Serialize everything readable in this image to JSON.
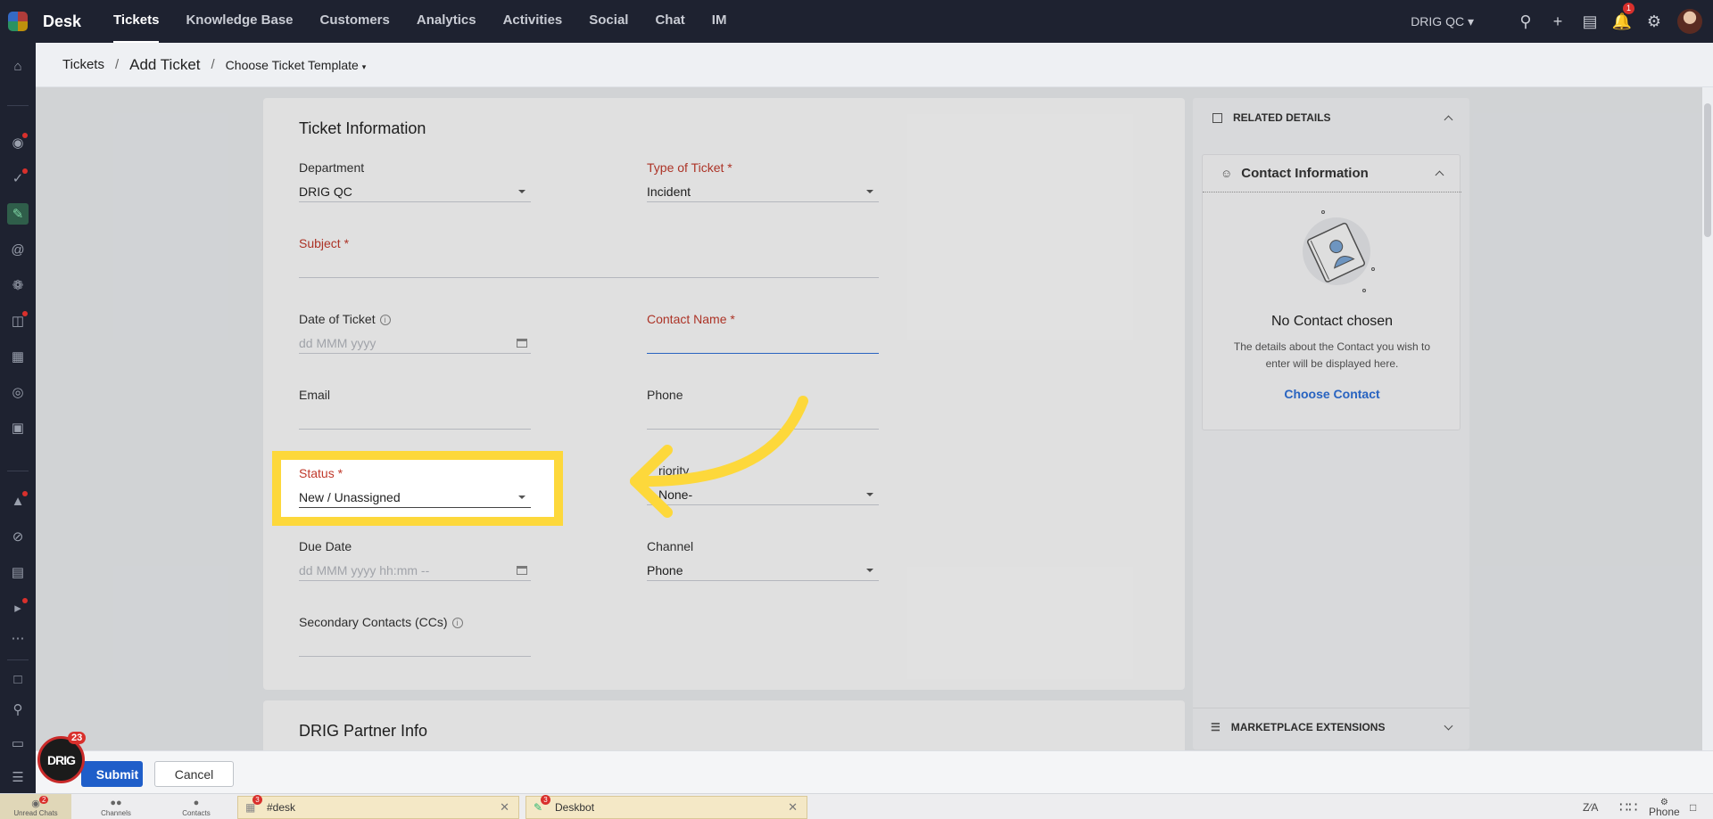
{
  "app": {
    "name": "Desk"
  },
  "nav": [
    "Tickets",
    "Knowledge Base",
    "Customers",
    "Analytics",
    "Activities",
    "Social",
    "Chat",
    "IM"
  ],
  "org": "DRIG QC",
  "notifications_count": "1",
  "breadcrumb": {
    "root": "Tickets",
    "current": "Add Ticket",
    "template": "Choose Ticket Template"
  },
  "form": {
    "section_title": "Ticket Information",
    "department": {
      "label": "Department",
      "value": "DRIG QC"
    },
    "type_of_ticket": {
      "label": "Type of Ticket *",
      "value": "Incident"
    },
    "subject": {
      "label": "Subject *",
      "value": ""
    },
    "date_of_ticket": {
      "label": "Date of Ticket",
      "placeholder": "dd MMM yyyy"
    },
    "contact_name": {
      "label": "Contact Name *",
      "value": ""
    },
    "email": {
      "label": "Email",
      "value": ""
    },
    "phone": {
      "label": "Phone",
      "value": ""
    },
    "status": {
      "label": "Status *",
      "value": "New / Unassigned"
    },
    "priority": {
      "label": "riority",
      "value": "None-"
    },
    "due_date": {
      "label": "Due Date",
      "placeholder": "dd MMM yyyy hh:mm --"
    },
    "channel": {
      "label": "Channel",
      "value": "Phone"
    },
    "secondary_contacts": {
      "label": "Secondary Contacts (CCs)",
      "value": ""
    }
  },
  "section2_title": "DRIG Partner Info",
  "related": {
    "header": "RELATED DETAILS",
    "contact_info": "Contact Information",
    "no_contact_title": "No Contact chosen",
    "no_contact_desc": "The details about the Contact you wish to enter will be displayed here.",
    "choose_contact": "Choose Contact",
    "marketplace": "MARKETPLACE EXTENSIONS"
  },
  "actions": {
    "submit": "Submit",
    "cancel": "Cancel"
  },
  "bot": {
    "label": "DRIG",
    "badge": "23"
  },
  "tray": {
    "tabs": [
      {
        "label": "Unread Chats",
        "badge": "2"
      },
      {
        "label": "Channels"
      },
      {
        "label": "Contacts"
      }
    ],
    "chats": [
      {
        "name": "#desk",
        "badge": "3"
      },
      {
        "name": "Deskbot",
        "badge": "3"
      }
    ],
    "phone": "Phone"
  },
  "colors": {
    "accent": "#1f5ec9",
    "highlight": "#fdd83b",
    "required": "#c0392b",
    "topbar": "#1e2230"
  }
}
